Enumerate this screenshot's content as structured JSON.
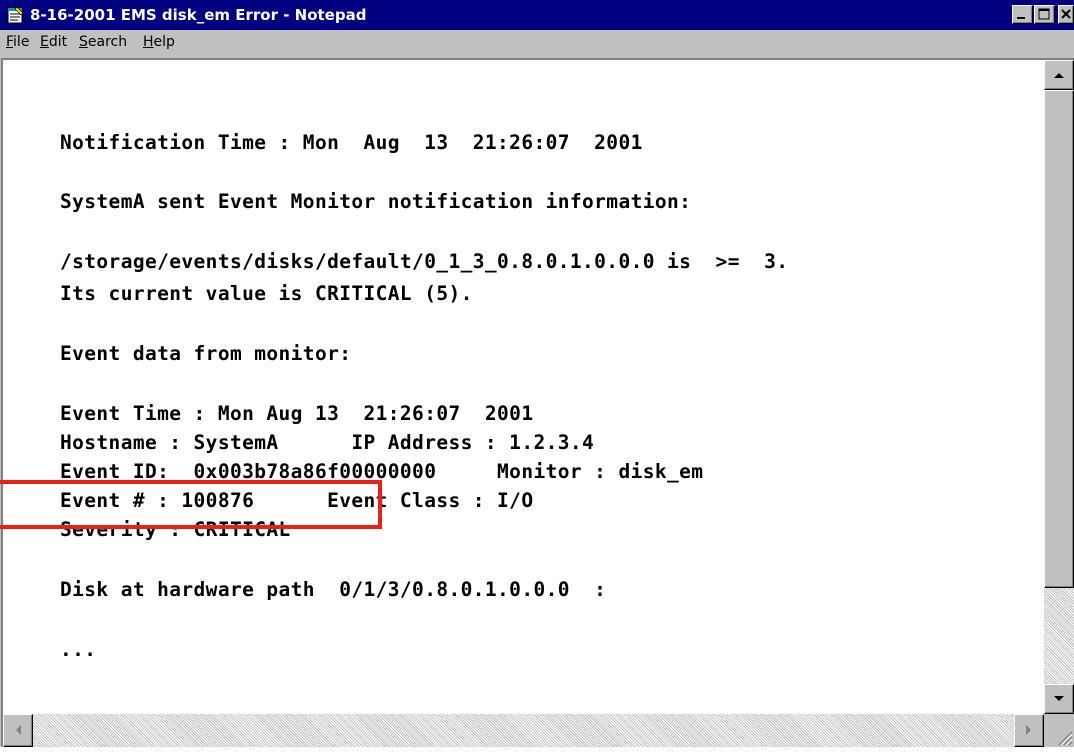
{
  "window": {
    "title": "8-16-2001 EMS disk_em Error - Notepad"
  },
  "menu": {
    "file": {
      "hotkey": "F",
      "rest": "ile"
    },
    "edit": {
      "hotkey": "E",
      "rest": "dit"
    },
    "search": {
      "hotkey": "S",
      "rest": "earch"
    },
    "help": {
      "hotkey": "H",
      "rest": "elp"
    }
  },
  "document": {
    "lines": [
      "Notification Time : Mon  Aug  13  21:26:07  2001",
      "SystemA sent Event Monitor notification information:",
      "/storage/events/disks/default/0_1_3_0.8.0.1.0.0.0 is  >=  3.",
      "Its current value is CRITICAL (5).",
      "Event data from monitor:",
      "Event Time : Mon Aug 13  21:26:07  2001",
      "Hostname : SystemA      IP Address : 1.2.3.4",
      "Event ID:  0x003b78a86f00000000     Monitor : disk_em",
      "Event # : 100876      Event Class : I/O",
      "Severity : CRITICAL",
      "Disk at hardware path  0/1/3/0.8.0.1.0.0.0  :",
      "..."
    ]
  },
  "annotation": {
    "highlight_color": "#e8201c"
  }
}
